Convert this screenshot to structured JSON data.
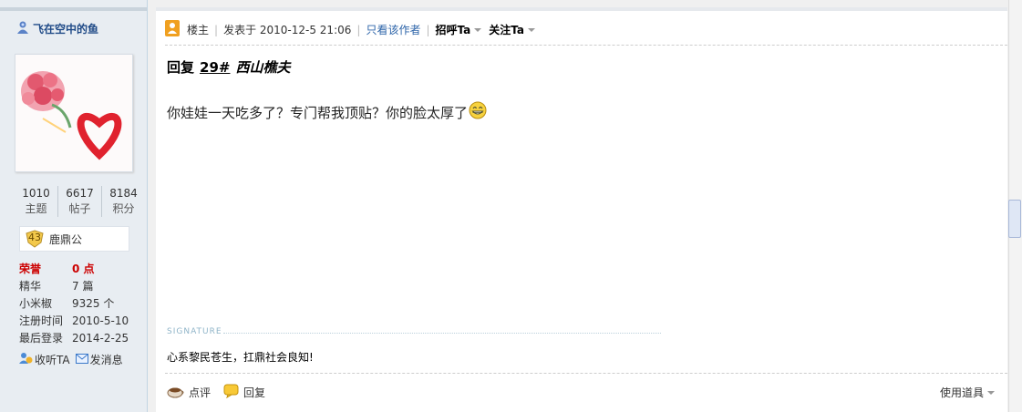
{
  "author": {
    "name": "飞在空中的鱼"
  },
  "stats": [
    {
      "value": "1010",
      "label": "主题"
    },
    {
      "value": "6617",
      "label": "帖子"
    },
    {
      "value": "8184",
      "label": "积分"
    }
  ],
  "rank": {
    "level": "43",
    "title": "鹿鼎公"
  },
  "info": [
    {
      "key": "荣誉",
      "value": "0 点"
    },
    {
      "key": "精华",
      "value": "7 篇"
    },
    {
      "key": "小米椒",
      "value": "9325 个"
    },
    {
      "key": "注册时间",
      "value": "2010-5-10"
    },
    {
      "key": "最后登录",
      "value": "2014-2-25"
    }
  ],
  "actions": {
    "follow": "收听TA",
    "message": "发消息"
  },
  "post_header": {
    "role": "楼主",
    "posted": "发表于 2010-12-5 21:06",
    "only_author": "只看该作者",
    "greet": "招呼Ta",
    "follow": "关注Ta"
  },
  "reply": {
    "prefix": "回复",
    "floor": "29#",
    "user": "西山樵夫"
  },
  "content": "你娃娃一天吃多了？专门帮我顶贴？你的脸太厚了",
  "signature": {
    "label": "SIGNATURE",
    "text": "心系黎民苍生，扛鼎社会良知!"
  },
  "footer": {
    "comment": "点评",
    "reply": "回复",
    "tools": "使用道具"
  },
  "colors": {
    "honor_red": "#cc0000",
    "link_blue": "#2b63a8",
    "sidebar_bg": "#e8edf2"
  }
}
